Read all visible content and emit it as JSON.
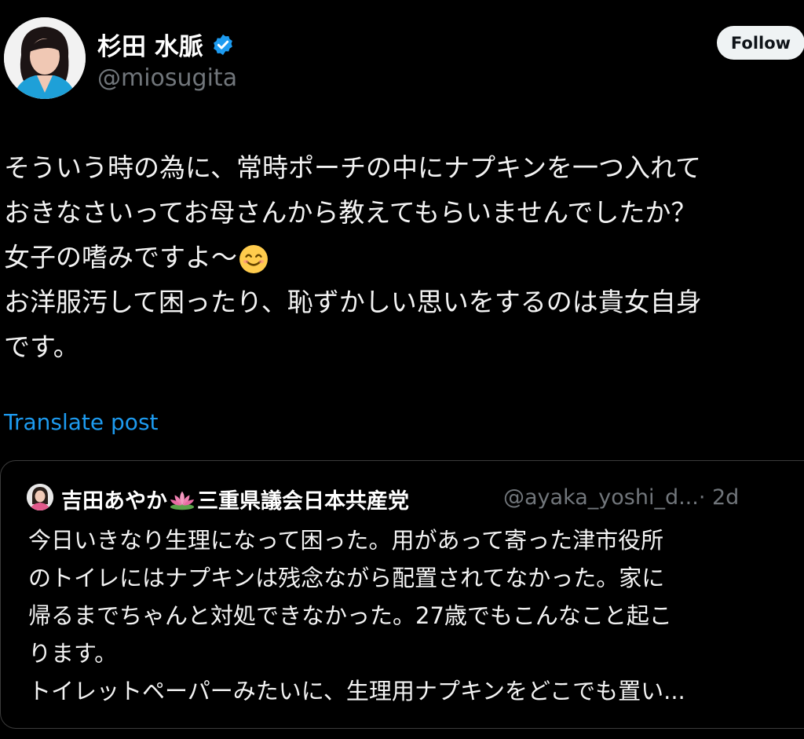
{
  "author": {
    "display_name": "杉田 水脈",
    "handle": "@miosugita"
  },
  "follow_button": {
    "label": "Follow"
  },
  "post": {
    "lines": [
      "そういう時の為に、常時ポーチの中にナプキンを一つ入れて",
      "おきなさいってお母さんから教えてもらいませんでしたか？",
      "女子の嗜みですよ〜",
      "お洋服汚して困ったり、恥ずかしい思いをするのは貴女自身",
      "です。"
    ],
    "emoji": "smiling-face-emoji"
  },
  "translate": {
    "label": "Translate post"
  },
  "quoted_post": {
    "name_part1": "吉田あやか",
    "name_emoji": "lotus-emoji",
    "name_part2": "三重県議会日本共産党",
    "handle_time": "@ayaka_yoshi_d...· 2d",
    "lines": [
      "今日いきなり生理になって困った。用があって寄った津市役所",
      "のトイレにはナプキンは残念ながら配置されてなかった。家に",
      "帰るまでちゃんと対処できなかった。27歳でもこんなこと起こ",
      "ります。",
      "トイレットペーパーみたいに、生理用ナプキンをどこでも置い..."
    ]
  },
  "colors": {
    "background": "#000000",
    "link": "#1d9bf0",
    "secondary_text": "#71767b",
    "verified": "#1d9bf0"
  }
}
